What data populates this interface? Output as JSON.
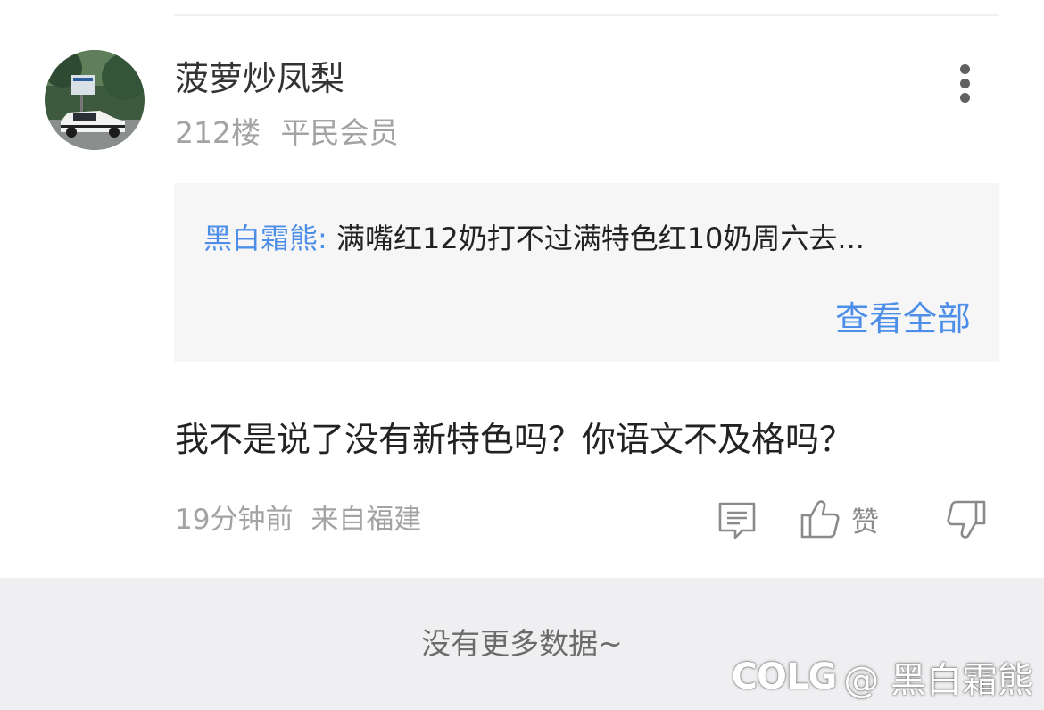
{
  "comment": {
    "username": "菠萝炒凤梨",
    "floor": "212楼",
    "member_level": "平民会员",
    "quote": {
      "author": "黑白霜熊:",
      "text": "满嘴红12奶打不过满特色红10奶周六去...",
      "view_all_label": "查看全部"
    },
    "body": "我不是说了没有新特色吗？你语文不及格吗？",
    "time": "19分钟前",
    "location": "来自福建",
    "like_label": "赞"
  },
  "list_end": {
    "text": "没有更多数据~"
  },
  "watermark": {
    "logo": "COLG",
    "handle": "@ 黑白霜熊"
  },
  "icons": {
    "more": "more-vertical-icon",
    "reply": "comment-icon",
    "like": "thumbs-up-icon",
    "dislike": "thumbs-down-icon"
  },
  "colors": {
    "link_blue": "#4d8ee8",
    "meta_gray": "#a3a3a3",
    "quote_bg": "#f6f6f7",
    "footer_bg": "#efeff1"
  }
}
